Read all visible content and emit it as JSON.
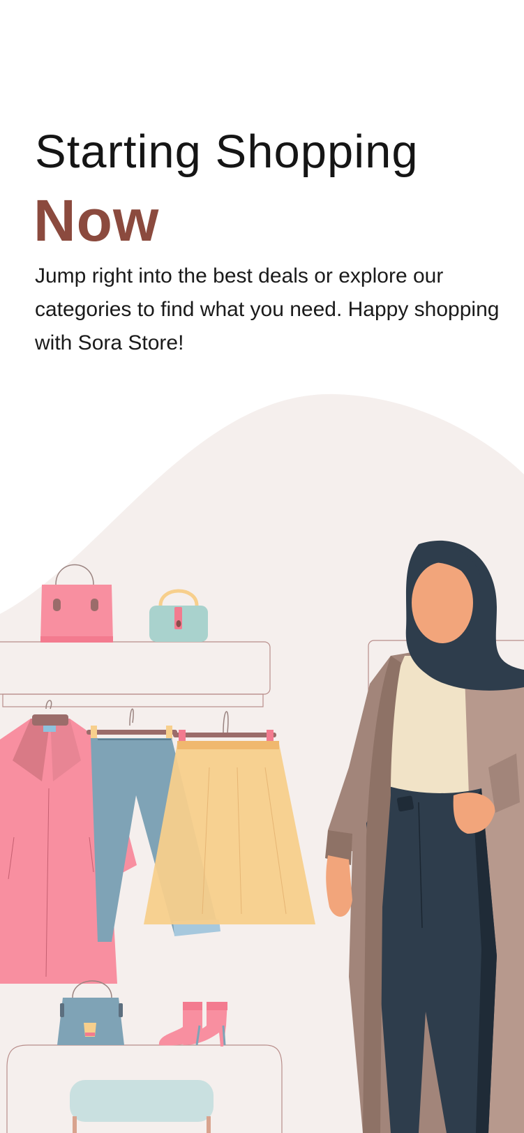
{
  "onboarding": {
    "headline": "Starting Shopping",
    "accent": "Now",
    "description": "Jump right into the best deals or explore our categories to find what you need. Happy shopping with Sora Store!"
  },
  "illustration": {
    "subject": "shopping-woman-illustration"
  },
  "colors": {
    "accent": "#8b4a3e",
    "text": "#151515",
    "blob": "#f5efed",
    "pink": "#f88fa0",
    "denim": "#7fa3b6",
    "yellow": "#f7cf8c",
    "navy": "#2e3d4c",
    "coat": "#a2857a",
    "skin": "#f2a57b",
    "cream": "#f1e3c7",
    "mint": "#a9d2cd"
  }
}
